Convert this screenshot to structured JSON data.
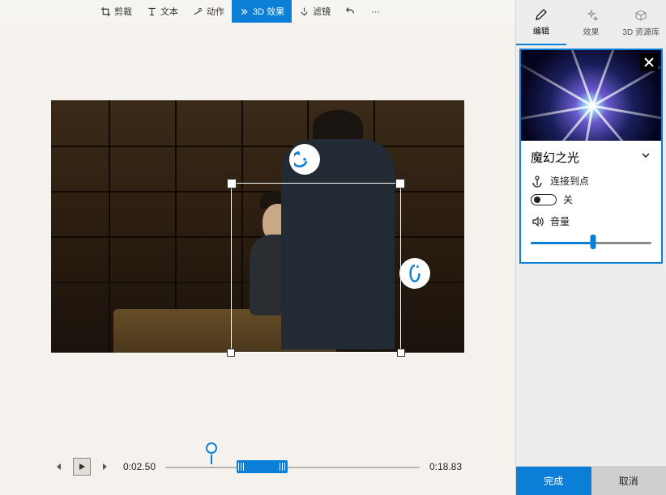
{
  "toolbar": {
    "items": [
      {
        "icon": "crop-icon",
        "label": "剪裁"
      },
      {
        "icon": "text-icon",
        "label": "文本"
      },
      {
        "icon": "motion-icon",
        "label": "动作"
      },
      {
        "icon": "effect-3d-icon",
        "label": "3D 效果",
        "active": true
      },
      {
        "icon": "filter-icon",
        "label": "滤镜"
      }
    ]
  },
  "timeline": {
    "current": "0:02.50",
    "total": "0:18.83",
    "playhead_pct": 16,
    "clip": {
      "start_pct": 28,
      "width_pct": 20
    }
  },
  "side": {
    "tabs": [
      {
        "icon": "pencil-icon",
        "label": "编辑",
        "active": true
      },
      {
        "icon": "sparkle-icon",
        "label": "效果"
      },
      {
        "icon": "cube-icon",
        "label": "3D 资源库"
      }
    ]
  },
  "effect": {
    "title": "魔幻之光",
    "anchor_label": "连接到点",
    "toggle_label": "关",
    "volume_label": "音量",
    "volume_pct": 52
  },
  "footer": {
    "done": "完成",
    "cancel": "取消"
  }
}
